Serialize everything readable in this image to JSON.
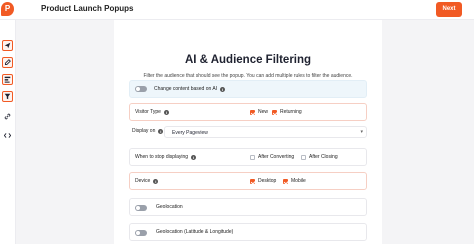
{
  "header": {
    "logo_letter": "P",
    "title": "Product Launch Popups",
    "next_label": "Next"
  },
  "sidebar": {
    "icons": [
      "send-icon",
      "pen-icon",
      "layout-icon",
      "funnel-icon",
      "link-icon",
      "code-icon"
    ]
  },
  "main": {
    "title": "AI & Audience Filtering",
    "subtitle": "Filter the audience that should see the popup. You can add multiple rules to filter the audience."
  },
  "rules": {
    "ai_label": "Change content based on AI",
    "visitor_type": {
      "label": "Visitor Type",
      "new": "New",
      "returning": "Returning"
    },
    "display_on": {
      "label": "Display on",
      "value": "Every Pageview"
    },
    "stop": {
      "label": "When to stop displaying",
      "after_converting": "After Converting",
      "after_closing": "After Closing"
    },
    "device": {
      "label": "Device",
      "desktop": "Desktop",
      "mobile": "Mobile"
    },
    "geolocation": "Geolocation",
    "geolocation_latlng": "Geolocation (Latitude & Longitude)"
  },
  "colors": {
    "accent": "#f15a24",
    "ai_bg": "#eef6fb"
  }
}
